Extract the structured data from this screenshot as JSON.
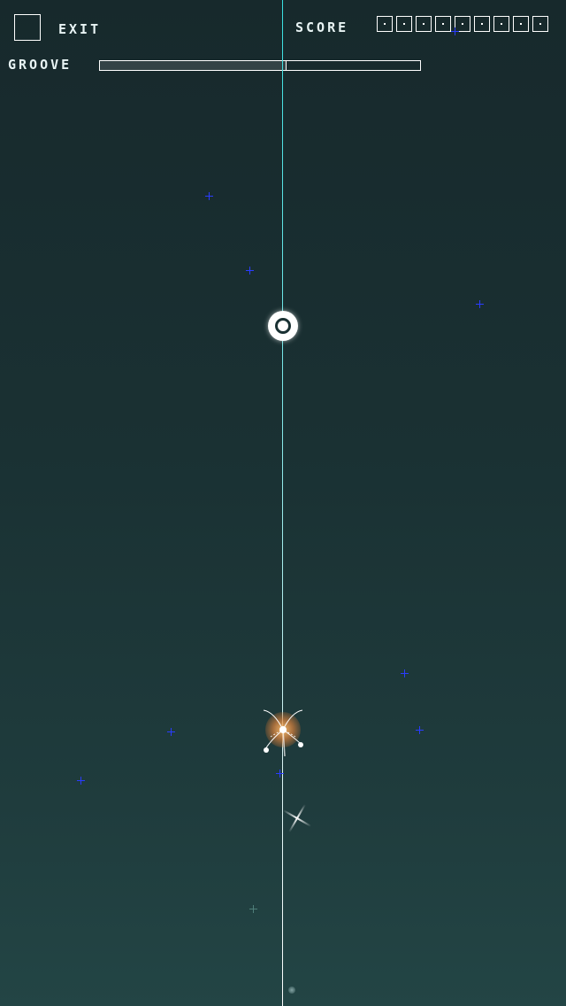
{
  "hud": {
    "exit_label": "EXIT",
    "score_label": "SCORE",
    "groove_label": "GROOVE",
    "score_digits": [
      "·",
      "·",
      "·",
      "·",
      "·",
      "·",
      "·",
      "·",
      "·"
    ],
    "groove_level_fraction": 0.58
  },
  "icons": {
    "exit": "exit-square-icon",
    "target": "ring-target-icon",
    "ship": "player-ship-icon",
    "star": "plus-star-icon",
    "sparkle": "sparkle-icon"
  },
  "colors": {
    "background_top": "#17292c",
    "background_bottom": "#234545",
    "rail_top": "#38e0e0",
    "rail_bottom": "#ffffff",
    "star": "#2a3cff",
    "ship_glow": "#e08a40",
    "hud": "#ffffff"
  }
}
